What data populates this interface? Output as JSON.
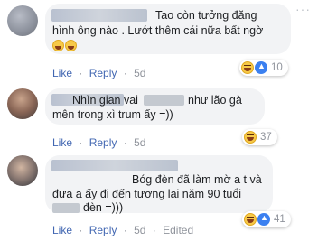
{
  "comments": [
    {
      "lines": [
        "Tao còn tưởng đăng",
        "hình ông nào . Lướt thêm cái nữa bất ngờ"
      ],
      "actions": {
        "like": "Like",
        "reply": "Reply",
        "time": "5d"
      },
      "reaction_count": "10"
    },
    {
      "lines": [
        "Nhìn gian vai",
        "như lão gà",
        "mên trong xì trum ấy =))"
      ],
      "actions": {
        "like": "Like",
        "reply": "Reply",
        "time": "5d"
      },
      "reaction_count": "37"
    },
    {
      "lines": [
        "Bóg đèn đã làm mờ a t và",
        "đưa a ấy đi đến tương lai năm 90 tuổi",
        "đèn =)))"
      ],
      "actions": {
        "like": "Like",
        "reply": "Reply",
        "time": "5d",
        "edited": "Edited"
      },
      "reaction_count": "41"
    }
  ],
  "separator": "·",
  "icons": {
    "haha": "haha-reaction-icon",
    "like": "like-reaction-icon",
    "more": "more-options-icon"
  },
  "colors": {
    "link": "#4267b2",
    "meta": "#90949c",
    "bubble": "#f2f3f5"
  }
}
